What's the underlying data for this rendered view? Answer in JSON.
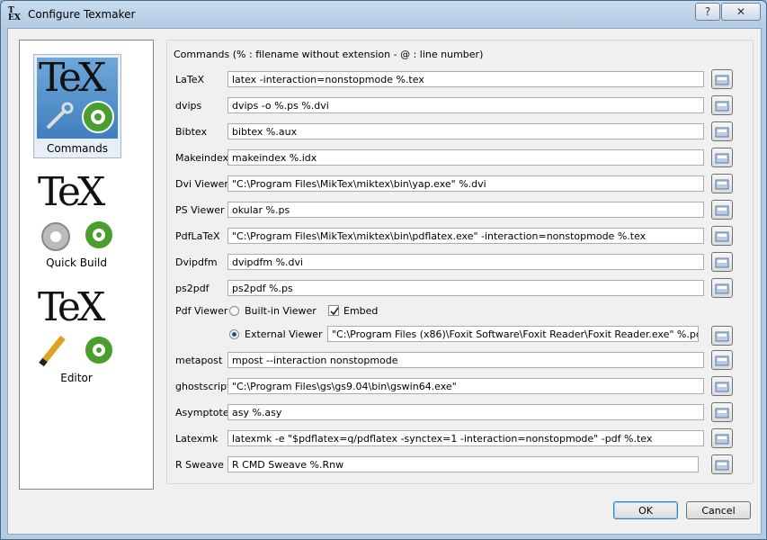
{
  "window": {
    "title": "Configure Texmaker",
    "help_glyph": "?",
    "close_glyph": "✕"
  },
  "sidebar": {
    "items": [
      {
        "label": "Commands",
        "image_text": "TeX",
        "selected": true
      },
      {
        "label": "Quick Build",
        "image_text": "TeX",
        "selected": false
      },
      {
        "label": "Editor",
        "image_text": "TeX",
        "selected": false
      }
    ]
  },
  "commands": {
    "group_title": "Commands (% : filename without extension - @ : line number)",
    "rows": [
      {
        "label": "LaTeX",
        "value": "latex -interaction=nonstopmode %.tex"
      },
      {
        "label": "dvips",
        "value": "dvips -o %.ps %.dvi"
      },
      {
        "label": "Bibtex",
        "value": "bibtex %.aux"
      },
      {
        "label": "Makeindex",
        "value": "makeindex %.idx"
      },
      {
        "label": "Dvi Viewer",
        "value": "\"C:\\Program Files\\MikTex\\miktex\\bin\\yap.exe\" %.dvi"
      },
      {
        "label": "PS Viewer",
        "value": "okular %.ps"
      },
      {
        "label": "PdfLaTeX",
        "value": "\"C:\\Program Files\\MikTex\\miktex\\bin\\pdflatex.exe\" -interaction=nonstopmode %.tex"
      },
      {
        "label": "Dvipdfm",
        "value": "dvipdfm %.dvi"
      },
      {
        "label": "ps2pdf",
        "value": "ps2pdf %.ps"
      }
    ],
    "pdf_viewer": {
      "label": "Pdf Viewer",
      "builtin_label": "Built-in Viewer",
      "embed_label": "Embed",
      "embed_checked": true,
      "external_label": "External Viewer",
      "external_selected": true,
      "external_value": "\"C:\\Program Files (x86)\\Foxit Software\\Foxit Reader\\Foxit Reader.exe\" %.pdf"
    },
    "rows2": [
      {
        "label": "metapost",
        "value": "mpost --interaction nonstopmode"
      },
      {
        "label": "ghostscript",
        "value": "\"C:\\Program Files\\gs\\gs9.04\\bin\\gswin64.exe\""
      },
      {
        "label": "Asymptote",
        "value": "asy %.asy"
      },
      {
        "label": "Latexmk",
        "value": "latexmk -e \"$pdflatex=q/pdflatex -synctex=1 -interaction=nonstopmode\" -pdf %.tex"
      },
      {
        "label": "R Sweave",
        "value": "R CMD Sweave %.Rnw"
      }
    ]
  },
  "buttons": {
    "ok": "OK",
    "cancel": "Cancel"
  }
}
